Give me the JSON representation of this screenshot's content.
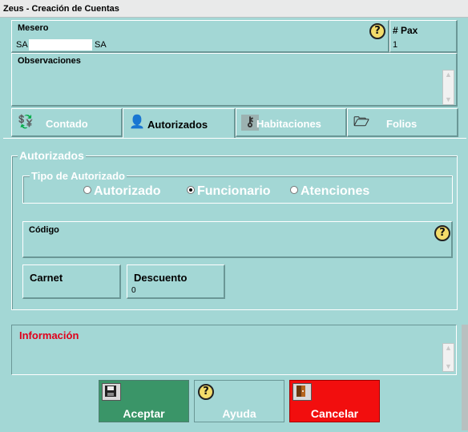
{
  "window": {
    "title": "Zeus - Creación de Cuentas"
  },
  "mesero": {
    "label": "Mesero",
    "code": "SA",
    "value": "",
    "suffix": "SA"
  },
  "pax": {
    "label": "# Pax",
    "value": "1"
  },
  "observaciones": {
    "label": "Observaciones",
    "value": ""
  },
  "tabs": [
    {
      "label": "Contado",
      "icon": "cash-icon",
      "active": false
    },
    {
      "label": "Autorizados",
      "icon": "authorized-person-icon",
      "active": true
    },
    {
      "label": "Habitaciones",
      "icon": "key-icon",
      "active": false
    },
    {
      "label": "Folios",
      "icon": "folder-icon",
      "active": false
    }
  ],
  "autorizados": {
    "title": "Autorizados",
    "tipo": {
      "legend": "Tipo de Autorizado",
      "options": [
        "Autorizado",
        "Funcionario",
        "Atenciones"
      ],
      "selected": "Funcionario"
    },
    "codigo": {
      "label": "Código",
      "value": ""
    },
    "carnet": {
      "label": "Carnet",
      "value": ""
    },
    "descuento": {
      "label": "Descuento",
      "value": "0"
    }
  },
  "informacion": {
    "label": "Información",
    "value": ""
  },
  "buttons": {
    "aceptar": {
      "label": "Aceptar",
      "icon": "save-icon"
    },
    "ayuda": {
      "label": "Ayuda",
      "icon": "help-icon"
    },
    "cancelar": {
      "label": "Cancelar",
      "icon": "exit-door-icon"
    }
  },
  "colors": {
    "background": "#a3d7d5",
    "accept": "#3a9568",
    "cancel": "#f20e0e",
    "info_label": "#e0001b"
  }
}
